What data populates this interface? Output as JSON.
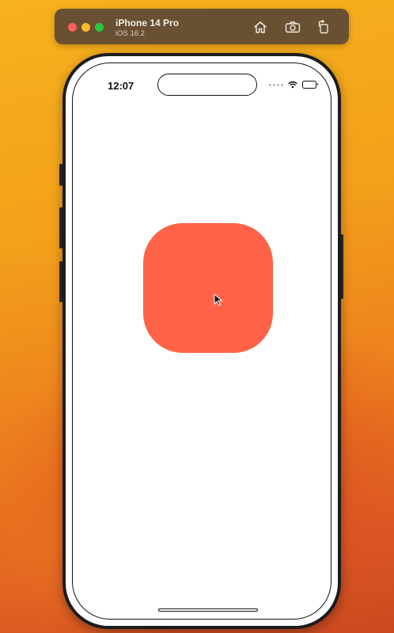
{
  "simulator": {
    "device_name": "iPhone 14 Pro",
    "os_version": "iOS 16.2",
    "toolbar": {
      "home_icon": "home-icon",
      "screenshot_icon": "camera-icon",
      "rotate_icon": "rotate-icon"
    }
  },
  "status_bar": {
    "time": "12:07",
    "icons": [
      "cellular-signal-icon",
      "wifi-icon",
      "battery-icon"
    ]
  },
  "app": {
    "tile_color": "#ff6347"
  },
  "colors": {
    "close": "#fe5f57",
    "minimize": "#febc2e",
    "zoom": "#28c840"
  }
}
